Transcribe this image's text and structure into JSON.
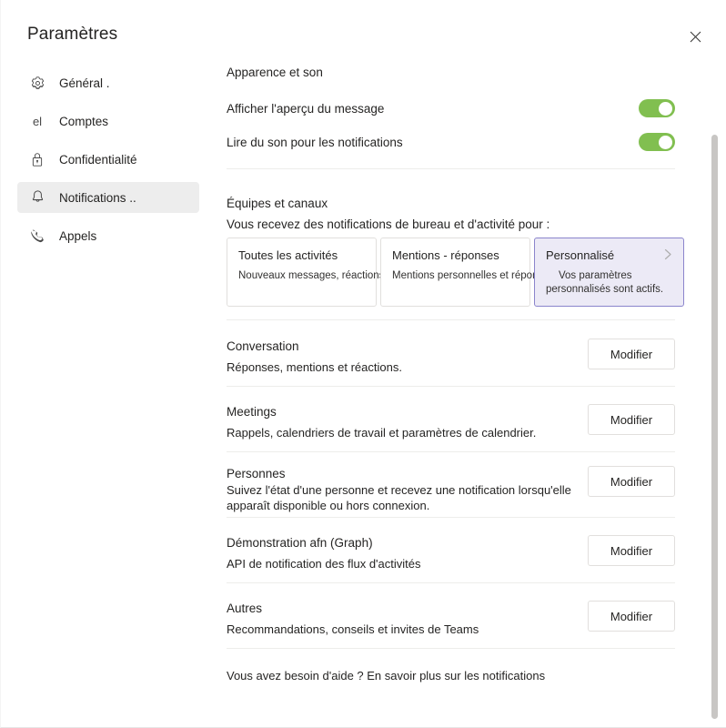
{
  "window": {
    "title": "Paramètres",
    "close_icon": "close-icon"
  },
  "sidebar": {
    "items": [
      {
        "label": "Général .",
        "icon": "gear-icon",
        "selected": false
      },
      {
        "label": "Comptes",
        "icon": "person-icon",
        "icon_text": "el",
        "selected": false
      },
      {
        "label": "Confidentialité",
        "icon": "lock-icon",
        "selected": false
      },
      {
        "label": "Notifications ..",
        "icon": "bell-icon",
        "selected": true
      },
      {
        "label": "Appels",
        "icon": "phone-icon",
        "selected": false
      }
    ]
  },
  "content": {
    "appearance": {
      "heading": "Apparence et son",
      "toggles": [
        {
          "label": "Afficher l'aperçu du message",
          "on": true
        },
        {
          "label": "Lire du son pour les notifications",
          "on": true
        }
      ]
    },
    "teams": {
      "heading": "Équipes et canaux",
      "subheading": "Vous recevez des notifications de bureau et d'activité pour :",
      "cards": [
        {
          "title": "Toutes les activités",
          "desc": "Nouveaux messages, réactions et toutes les mentions",
          "selected": false,
          "chevron": false
        },
        {
          "title": "Mentions - réponses",
          "desc": "Mentions personnelles et réponses à vos messages",
          "selected": false,
          "chevron": false
        },
        {
          "title": "Personnalisé",
          "desc": "Vos paramètres personnalisés sont actifs.",
          "selected": true,
          "chevron": true
        }
      ]
    },
    "settings_rows": [
      {
        "title": "Conversation",
        "desc": "Réponses, mentions et réactions.",
        "button": "Modifier"
      },
      {
        "title": "Meetings",
        "desc": "Rappels, calendriers de travail et paramètres de calendrier.",
        "button": "Modifier"
      },
      {
        "title": "Personnes",
        "desc": "Suivez l'état d'une personne et recevez une notification lorsqu'elle apparaît disponible ou hors connexion.",
        "button": "Modifier"
      },
      {
        "title": "Démonstration afn (Graph)",
        "desc": "API de notification des flux d'activités",
        "button": "Modifier"
      },
      {
        "title": "Autres",
        "desc": "Recommandations, conseils et invites de Teams",
        "button": "Modifier"
      }
    ],
    "help_text": "Vous avez besoin d'aide ? En savoir plus sur les notifications"
  },
  "colors": {
    "toggle_on": "#81bf50",
    "selected_card_bg": "#eceaf6",
    "selected_card_border": "#8b85cc",
    "selected_nav_bg": "#ededed",
    "divider": "#ededeb",
    "scrollbar": "#c8c6c4"
  }
}
